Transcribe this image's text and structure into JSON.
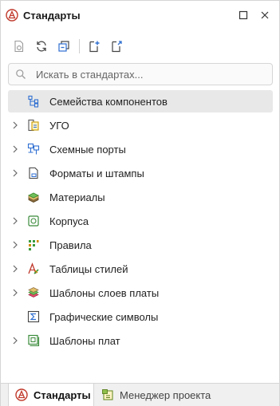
{
  "window": {
    "title": "Стандарты"
  },
  "search": {
    "placeholder": "Искать в стандартах..."
  },
  "tree": {
    "items": [
      {
        "label": "Семейства компонентов",
        "icon": "component-families-icon",
        "expandable": false,
        "selected": true
      },
      {
        "label": "УГО",
        "icon": "symbol-library-icon",
        "expandable": true,
        "selected": false
      },
      {
        "label": "Схемные порты",
        "icon": "schematic-ports-icon",
        "expandable": true,
        "selected": false
      },
      {
        "label": "Форматы и штампы",
        "icon": "formats-stamps-icon",
        "expandable": true,
        "selected": false
      },
      {
        "label": "Материалы",
        "icon": "materials-icon",
        "expandable": false,
        "selected": false
      },
      {
        "label": "Корпуса",
        "icon": "packages-icon",
        "expandable": true,
        "selected": false
      },
      {
        "label": "Правила",
        "icon": "rules-icon",
        "expandable": true,
        "selected": false
      },
      {
        "label": "Таблицы стилей",
        "icon": "style-tables-icon",
        "expandable": true,
        "selected": false
      },
      {
        "label": "Шаблоны слоев платы",
        "icon": "layer-templates-icon",
        "expandable": true,
        "selected": false
      },
      {
        "label": "Графические символы",
        "icon": "graphic-symbols-icon",
        "expandable": false,
        "selected": false
      },
      {
        "label": "Шаблоны плат",
        "icon": "board-templates-icon",
        "expandable": true,
        "selected": false
      }
    ]
  },
  "tabs": [
    {
      "label": "Стандарты",
      "active": true
    },
    {
      "label": "Менеджер проекта",
      "active": false
    }
  ]
}
